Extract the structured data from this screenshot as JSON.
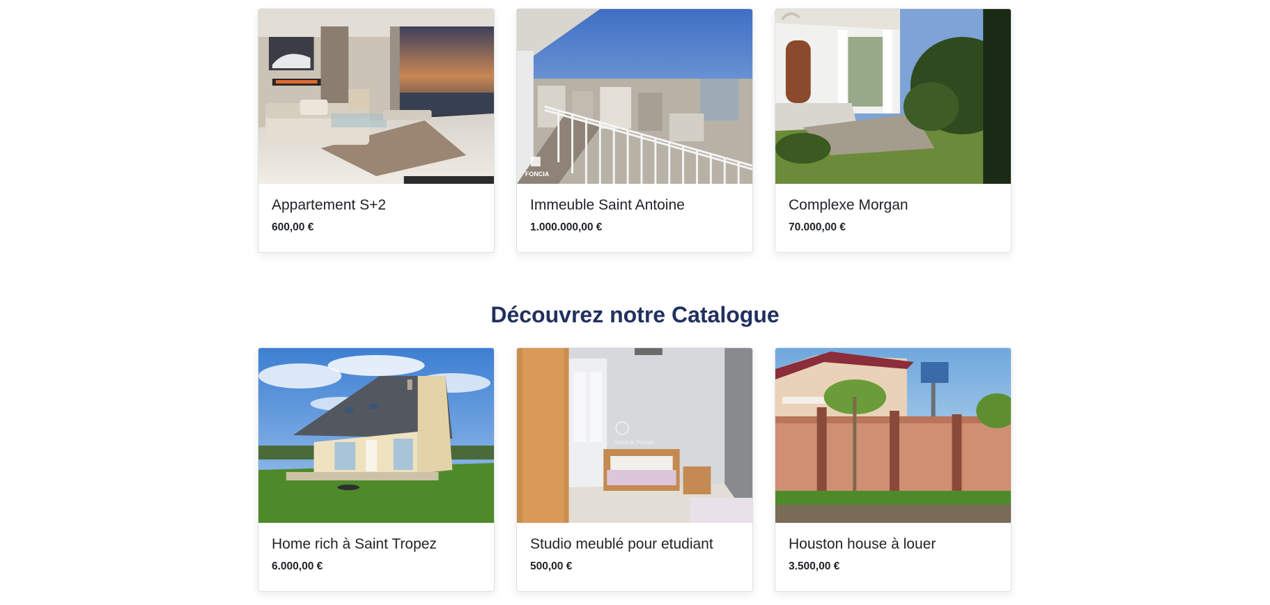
{
  "featured": [
    {
      "title": "Appartement S+2",
      "price": "600,00 €",
      "image": "living-room-photo"
    },
    {
      "title": "Immeuble Saint Antoine",
      "price": "1.000.000,00 €",
      "image": "balcony-city-view-photo",
      "logo_text": "FONCIA"
    },
    {
      "title": "Complexe Morgan",
      "price": "70.000,00 €",
      "image": "villa-entrance-photo"
    }
  ],
  "catalogue": {
    "heading": "Découvrez notre Catalogue",
    "items": [
      {
        "title": "Home rich à Saint Tropez",
        "price": "6.000,00 €",
        "image": "house-lawn-photo"
      },
      {
        "title": "Studio meublé pour etudiant",
        "price": "500,00 €",
        "image": "bedroom-photo",
        "watermark": "Home in Tunisia"
      },
      {
        "title": "Houston house à louer",
        "price": "3.500,00 €",
        "image": "house-wall-palms-photo"
      }
    ]
  }
}
